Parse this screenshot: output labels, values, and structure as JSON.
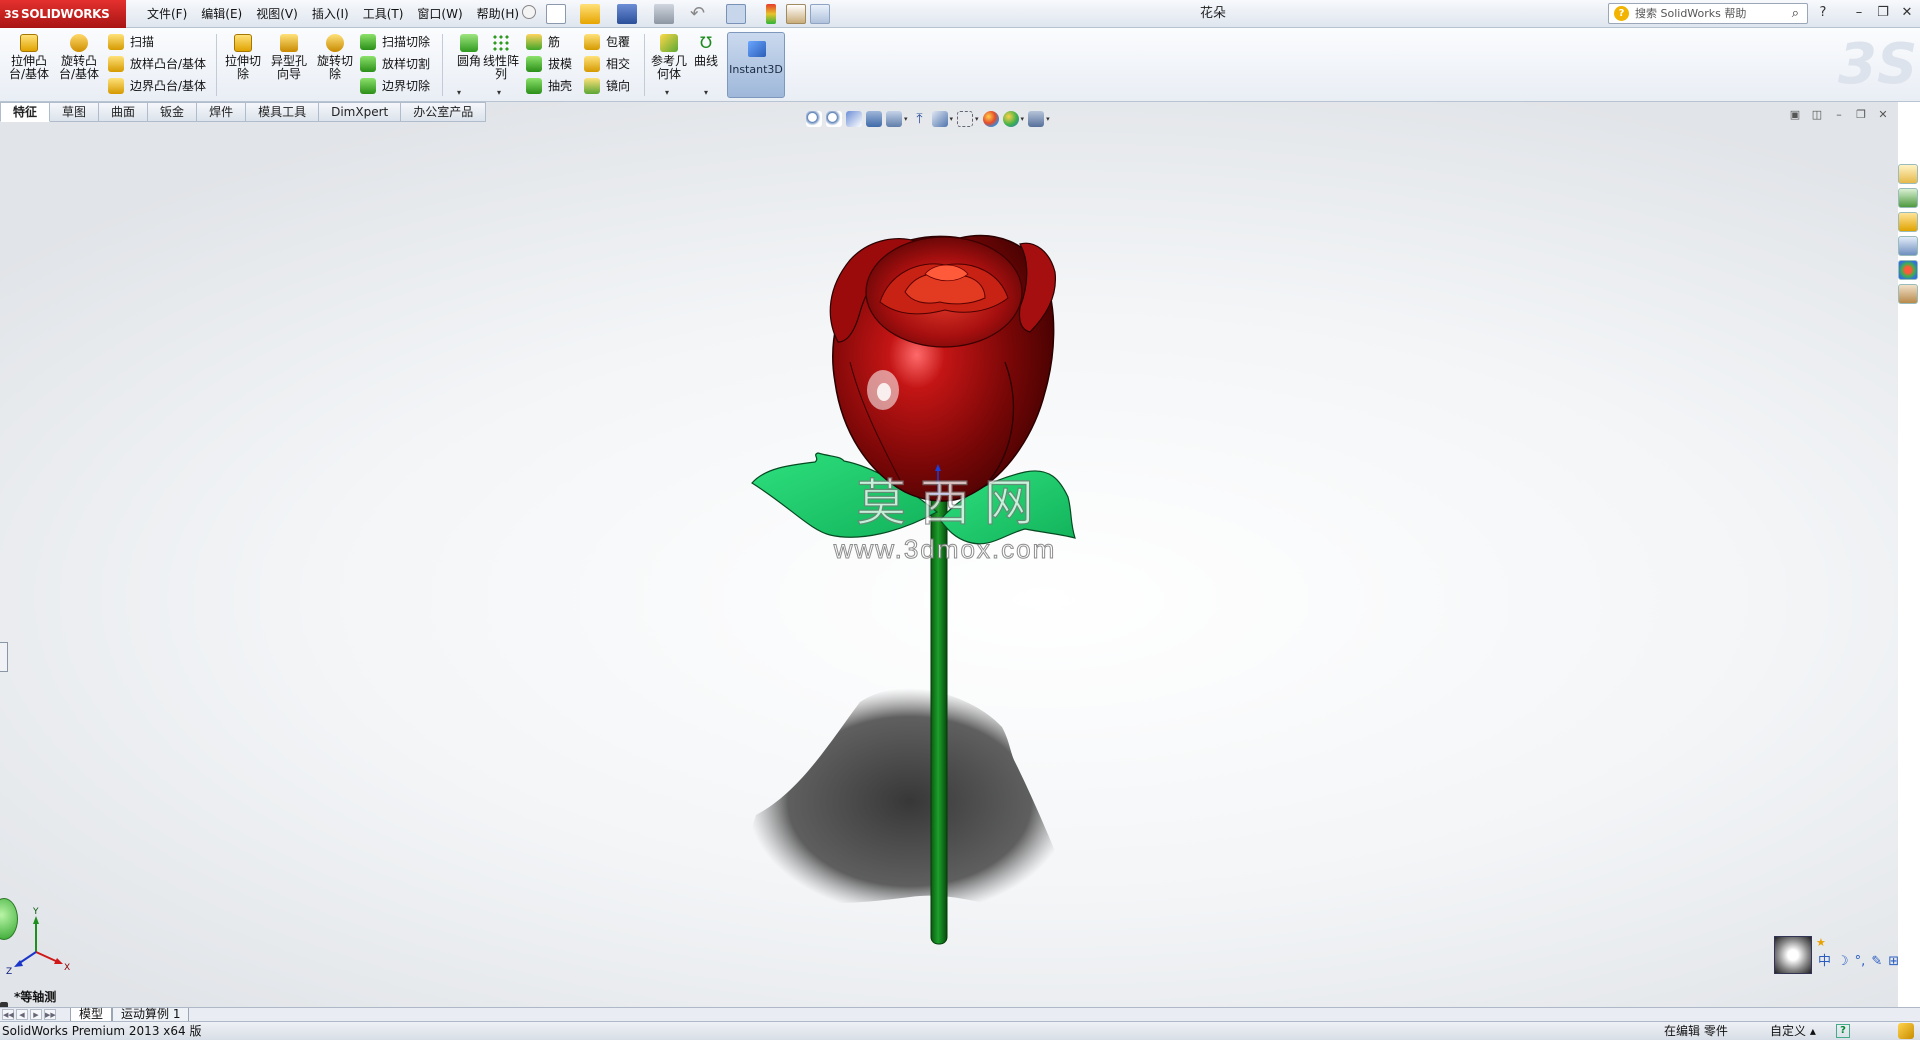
{
  "app": {
    "logo_text": "SOLIDWORKS",
    "logo_prefix": "3S",
    "window_title": "花朵",
    "help_search_placeholder": "搜索 SolidWorks 帮助"
  },
  "menu": [
    {
      "label": "文件(F)"
    },
    {
      "label": "编辑(E)"
    },
    {
      "label": "视图(V)"
    },
    {
      "label": "插入(I)"
    },
    {
      "label": "工具(T)"
    },
    {
      "label": "窗口(W)"
    },
    {
      "label": "帮助(H)"
    }
  ],
  "commands": {
    "extrude_boss": "拉伸凸台/基体",
    "revolve_boss": "旋转凸台/基体",
    "sweep": "扫描",
    "loft_boss": "放样凸台/基体",
    "boundary_boss": "边界凸台/基体",
    "extrude_cut": "拉伸切除",
    "hole_wizard": "异型孔向导",
    "revolve_cut": "旋转切除",
    "sweep_cut": "扫描切除",
    "loft_cut": "放样切割",
    "boundary_cut": "边界切除",
    "fillet": "圆角",
    "linear_pattern": "线性阵列",
    "rib": "筋",
    "draft": "拔模",
    "shell": "抽壳",
    "wrap": "包覆",
    "intersect": "相交",
    "mirror": "镜向",
    "reference_geometry": "参考几何体",
    "curves": "曲线",
    "instant3d": "Instant3D"
  },
  "tabs": [
    {
      "label": "特征",
      "active": true
    },
    {
      "label": "草图"
    },
    {
      "label": "曲面"
    },
    {
      "label": "钣金"
    },
    {
      "label": "焊件"
    },
    {
      "label": "模具工具"
    },
    {
      "label": "DimXpert"
    },
    {
      "label": "办公室产品"
    }
  ],
  "viewport": {
    "view_orientation": "*等轴测",
    "watermark_chars": "莫 西 网",
    "watermark_url": "www.3dmox.com",
    "ime_chars": [
      "中",
      "☽",
      "°,",
      "✎",
      "⊞"
    ],
    "colors": {
      "petal": "#8a0b0b",
      "leaf": "#1fcf6a",
      "stem": "#0f7a1a",
      "shadow": "#3a3a3a"
    }
  },
  "bottom_tabs": [
    {
      "label": "模型",
      "active": true
    },
    {
      "label": "运动算例 1"
    }
  ],
  "status": {
    "product": "SolidWorks Premium 2013 x64 版",
    "edit_mode": "在编辑 零件",
    "customize": "自定义",
    "customize_caret": "▴",
    "help_icon_text": "?"
  }
}
